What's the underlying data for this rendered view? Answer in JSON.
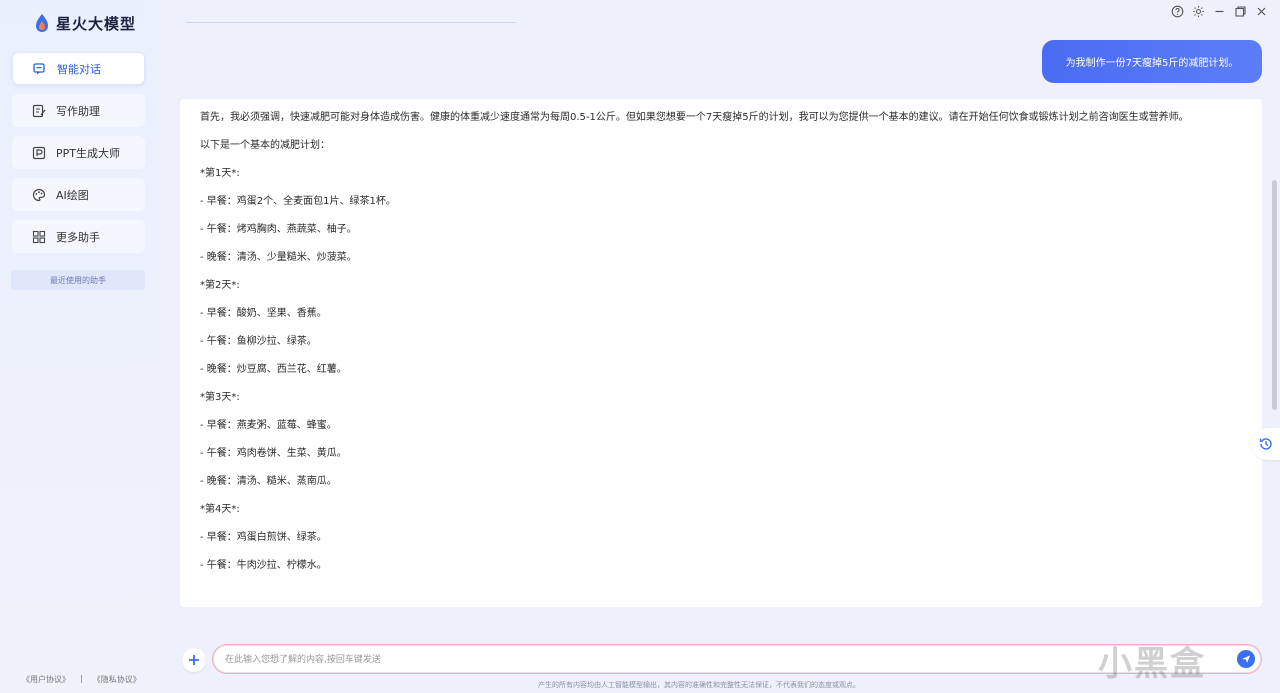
{
  "app": {
    "title": "星火大模型"
  },
  "sidebar": {
    "items": [
      {
        "label": "智能对话",
        "icon": "chat-icon",
        "active": true
      },
      {
        "label": "写作助理",
        "icon": "writing-icon"
      },
      {
        "label": "PPT生成大师",
        "icon": "ppt-icon"
      },
      {
        "label": "AI绘图",
        "icon": "palette-icon"
      },
      {
        "label": "更多助手",
        "icon": "grid-icon"
      }
    ],
    "recent_label": "最近使用的助手",
    "footer": {
      "user_agreement": "《用户协议》",
      "privacy": "《隐私协议》"
    }
  },
  "chat": {
    "user_message": "为我制作一份7天瘦掉5斤的减肥计划。",
    "answer_lines": [
      "首先，我必须强调，快速减肥可能对身体造成伤害。健康的体重减少速度通常为每周0.5-1公斤。但如果您想要一个7天瘦掉5斤的计划，我可以为您提供一个基本的建议。请在开始任何饮食或锻炼计划之前咨询医生或营养师。",
      "以下是一个基本的减肥计划：",
      "*第1天*:",
      "- 早餐：鸡蛋2个、全麦面包1片、绿茶1杯。",
      "- 午餐：烤鸡胸肉、燕蔬菜、柚子。",
      "- 晚餐：清汤、少量糙米、炒菠菜。",
      "*第2天*:",
      "- 早餐：酸奶、坚果、香蕉。",
      "- 午餐：鱼柳沙拉、绿茶。",
      "- 晚餐：炒豆腐、西兰花、红薯。",
      "*第3天*:",
      "- 早餐：燕麦粥、蓝莓、蜂蜜。",
      "- 午餐：鸡肉卷饼、生菜、黄瓜。",
      "- 晚餐：清汤、糙米、蒸南瓜。",
      "*第4天*:",
      "- 早餐：鸡蛋白煎饼、绿茶。",
      "- 午餐：牛肉沙拉、柠檬水。"
    ]
  },
  "input": {
    "placeholder": "在此输入您想了解的内容,按回车键发送"
  },
  "disclaimer": "产生的所有内容均由人工智能模型输出，其内容的准确性和完整性无法保证，不代表我们的态度或观点。",
  "watermark": "小黑盒",
  "colors": {
    "accent": "#3a6ff0",
    "user_bubble": "#4a6cf2"
  }
}
